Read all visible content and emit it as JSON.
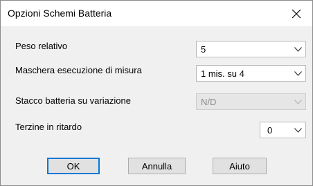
{
  "window": {
    "title": "Opzioni Schemi Batteria",
    "close_icon": "close-icon"
  },
  "fields": {
    "peso_relativo": {
      "label": "Peso relativo",
      "value": "5"
    },
    "maschera": {
      "label": "Maschera esecuzione di misura",
      "value": "1 mis. su 4"
    },
    "stacco": {
      "label": "Stacco batteria su variazione",
      "value": "N/D",
      "disabled": true
    },
    "terzine": {
      "label": "Terzine in ritardo",
      "value": "0"
    }
  },
  "buttons": {
    "ok": "OK",
    "annulla": "Annulla",
    "aiuto": "Aiuto"
  },
  "colors": {
    "default_button_border": "#0078d7",
    "dialog_background": "#f0f0f0"
  }
}
